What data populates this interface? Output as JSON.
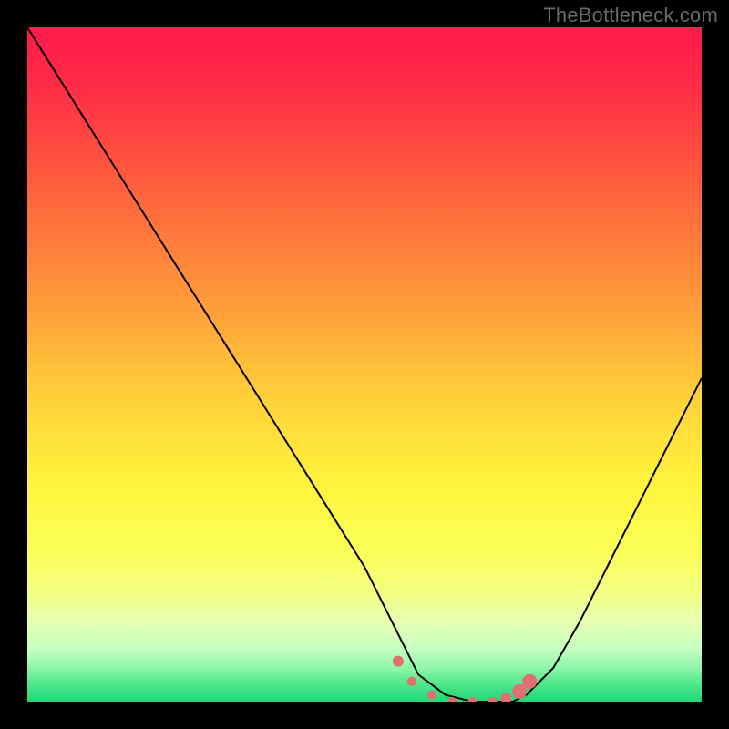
{
  "watermark": {
    "text": "TheBottleneck.com"
  },
  "chart_data": {
    "type": "line",
    "title": "",
    "xlabel": "",
    "ylabel": "",
    "xlim": [
      0,
      100
    ],
    "ylim": [
      0,
      100
    ],
    "gradient_stops": [
      {
        "offset": 0,
        "color": "#ff1a4b"
      },
      {
        "offset": 0.08,
        "color": "#ff2a47"
      },
      {
        "offset": 0.22,
        "color": "#ff5a3e"
      },
      {
        "offset": 0.4,
        "color": "#ff983a"
      },
      {
        "offset": 0.55,
        "color": "#ffd13a"
      },
      {
        "offset": 0.68,
        "color": "#fff43d"
      },
      {
        "offset": 0.78,
        "color": "#fbff58"
      },
      {
        "offset": 0.84,
        "color": "#f3ff86"
      },
      {
        "offset": 0.88,
        "color": "#e8ffb0"
      },
      {
        "offset": 0.92,
        "color": "#c8ffc0"
      },
      {
        "offset": 0.95,
        "color": "#8ef7a8"
      },
      {
        "offset": 0.975,
        "color": "#4de68a"
      },
      {
        "offset": 1.0,
        "color": "#1fd877"
      }
    ],
    "series": [
      {
        "name": "curve",
        "color": "#000000",
        "width": 2,
        "x": [
          0,
          5,
          10,
          15,
          20,
          25,
          30,
          35,
          40,
          45,
          50,
          54,
          56,
          58,
          62,
          66,
          70,
          72,
          74,
          78,
          82,
          86,
          90,
          94,
          98,
          100
        ],
        "values": [
          100,
          92,
          84,
          76,
          68,
          60,
          52,
          44,
          36,
          28,
          20,
          12,
          8,
          4,
          1,
          0,
          0,
          0,
          1,
          5,
          12,
          20,
          28,
          36,
          44,
          48
        ]
      }
    ],
    "highlight": {
      "comment": "pink circular markers near the trough",
      "color": "#e07070",
      "radius_small": 5,
      "radius_large": 8,
      "points": [
        {
          "x": 55,
          "y": 6,
          "r": 6
        },
        {
          "x": 57,
          "y": 3,
          "r": 5
        },
        {
          "x": 60,
          "y": 1,
          "r": 5
        },
        {
          "x": 63,
          "y": 0,
          "r": 5
        },
        {
          "x": 66,
          "y": 0,
          "r": 5
        },
        {
          "x": 69,
          "y": 0,
          "r": 5
        },
        {
          "x": 71,
          "y": 0.5,
          "r": 6
        },
        {
          "x": 73,
          "y": 1.5,
          "r": 8
        },
        {
          "x": 74.5,
          "y": 3,
          "r": 8
        }
      ]
    }
  }
}
